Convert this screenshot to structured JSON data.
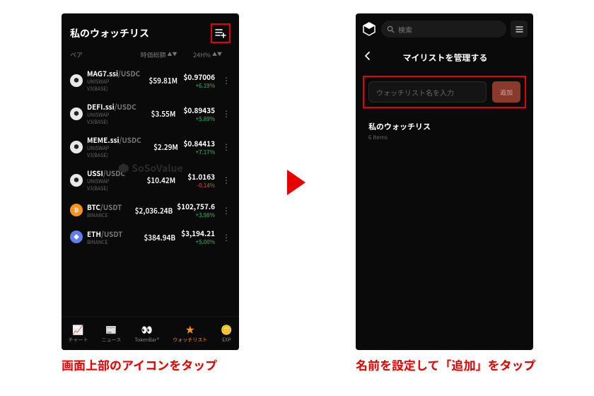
{
  "left": {
    "title": "私のウォッチリス",
    "columns": {
      "pair": "ペア",
      "mcap": "時価総額",
      "chg": "24H%"
    },
    "rows": [
      {
        "icon": "white",
        "sym": "MAG7.ssi",
        "quote": "/USDC",
        "ex": "UNISWAP",
        "ex2": "V3(BASE)",
        "mcap": "$59.81M",
        "price": "$0.97006",
        "chg": "+6.19%",
        "pos": true
      },
      {
        "icon": "white",
        "sym": "DEFI.ssi",
        "quote": "/USDC",
        "ex": "UNISWAP",
        "ex2": "V3(BASE)",
        "mcap": "$3.55M",
        "price": "$0.89435",
        "chg": "+5.89%",
        "pos": true
      },
      {
        "icon": "white",
        "sym": "MEME.ssi",
        "quote": "/USDC",
        "ex": "UNISWAP",
        "ex2": "V3(BASE)",
        "mcap": "$2.29M",
        "price": "$0.84413",
        "chg": "+7.17%",
        "pos": true
      },
      {
        "icon": "white",
        "sym": "USSI",
        "quote": "/USDC",
        "ex": "UNISWAP",
        "ex2": "V3(BASE)",
        "mcap": "$10.42M",
        "price": "$1.0163",
        "chg": "-0.14%",
        "pos": false
      },
      {
        "icon": "orange",
        "sym": "BTC",
        "quote": "/USDT",
        "ex": "BINANCE",
        "ex2": "",
        "mcap": "$2,036.24B",
        "price": "$102,757.6",
        "chg": "+3.98%",
        "pos": true
      },
      {
        "icon": "eth",
        "sym": "ETH",
        "quote": "/USDT",
        "ex": "BINANCE",
        "ex2": "",
        "mcap": "$384.94B",
        "price": "$3,194.21",
        "chg": "+5.00%",
        "pos": true
      }
    ],
    "nav": [
      {
        "label": "チャート",
        "icon": "📈"
      },
      {
        "label": "ニュース",
        "icon": "📰"
      },
      {
        "label": "TokenBar®",
        "icon": "👀"
      },
      {
        "label": "ウォッチリスト",
        "icon": "★",
        "active": true
      },
      {
        "label": "EXP",
        "icon": "🪙"
      }
    ],
    "watermark": "SoSoValue"
  },
  "right": {
    "search_placeholder": "検索",
    "title": "マイリストを管理する",
    "input_placeholder": "ウォッチリスト名を入力",
    "add_label": "追加",
    "list_name": "私のウォッチリス",
    "list_count": "6 items"
  },
  "captions": {
    "left": "画面上部のアイコンをタップ",
    "right": "名前を設定して「追加」をタップ"
  }
}
